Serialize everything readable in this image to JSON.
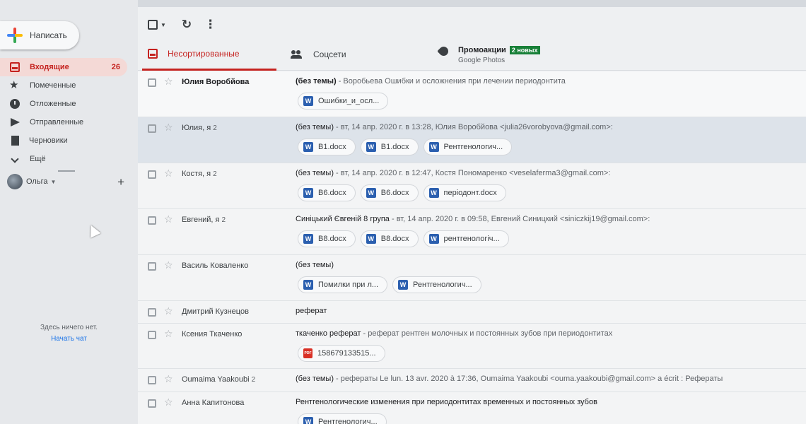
{
  "compose": {
    "label": "Написать"
  },
  "nav": [
    {
      "label": "Входящие",
      "icon": "inbox-icon",
      "count": "26",
      "active": true
    },
    {
      "label": "Помеченные",
      "icon": "star-icon"
    },
    {
      "label": "Отложенные",
      "icon": "clock-icon"
    },
    {
      "label": "Отправленные",
      "icon": "send-icon"
    },
    {
      "label": "Черновики",
      "icon": "draft-icon"
    },
    {
      "label": "Ещё",
      "icon": "chevron-down-icon"
    }
  ],
  "hangouts": {
    "user": "Ольга",
    "empty_text": "Здесь ничего нет.",
    "start_chat": "Начать чат"
  },
  "tabs": {
    "primary": "Несортированные",
    "social": "Соцсети",
    "promo": {
      "label": "Промоакции",
      "badge": "2 новых",
      "sub": "Google Photos"
    }
  },
  "emails": [
    {
      "sender": "Юлия Воробйова",
      "count": "",
      "subject": "(без темы)",
      "snippet": " - Воробьева Ошибки и осложнения при лечении периодонтита",
      "attachments": [
        {
          "type": "word",
          "name": "Ошибки_и_осл..."
        }
      ],
      "unread": true
    },
    {
      "sender": "Юлия, я",
      "count": "2",
      "subject": "(без темы)",
      "snippet": " - вт, 14 апр. 2020 г. в 13:28, Юлия Воробйова <julia26vorobyova@gmail.com>:",
      "attachments": [
        {
          "type": "word",
          "name": "В1.docx"
        },
        {
          "type": "word",
          "name": "В1.docx"
        },
        {
          "type": "word",
          "name": "Рентгенологич..."
        }
      ],
      "selected": true
    },
    {
      "sender": "Костя, я",
      "count": "2",
      "subject": "(без темы)",
      "snippet": " - вт, 14 апр. 2020 г. в 12:47, Костя Пономаренко <veselaferma3@gmail.com>:",
      "attachments": [
        {
          "type": "word",
          "name": "В6.docx"
        },
        {
          "type": "word",
          "name": "В6.docx"
        },
        {
          "type": "word",
          "name": "періодонт.docx"
        }
      ]
    },
    {
      "sender": "Евгений, я",
      "count": "2",
      "subject": "Синіцький Євгеній 8 група",
      "snippet": " - вт, 14 апр. 2020 г. в 09:58, Евгений Синицкий <siniczkij19@gmail.com>:",
      "attachments": [
        {
          "type": "word",
          "name": "В8.docx"
        },
        {
          "type": "word",
          "name": "В8.docx"
        },
        {
          "type": "word",
          "name": "рентгенологіч..."
        }
      ]
    },
    {
      "sender": "Василь Коваленко",
      "count": "",
      "subject": "(без темы)",
      "snippet": "",
      "attachments": [
        {
          "type": "word",
          "name": "Помилки при л..."
        },
        {
          "type": "word",
          "name": "Рентгенологич..."
        }
      ]
    },
    {
      "sender": "Дмитрий Кузнецов",
      "count": "",
      "subject": "реферат",
      "snippet": "",
      "attachments": []
    },
    {
      "sender": "Ксения Ткаченко",
      "count": "",
      "subject": "ткаченко реферат",
      "snippet": " - реферат рентген молочных и постоянных зубов при периодонтитах",
      "attachments": [
        {
          "type": "pdf",
          "name": "158679133515..."
        }
      ]
    },
    {
      "sender": "Oumaima Yaakoubi",
      "count": "2",
      "subject": "(без темы)",
      "snippet": " - рефераты Le lun. 13 avr. 2020 à 17:36, Oumaima Yaakoubi <ouma.yaakoubi@gmail.com> a écrit : Рефераты",
      "attachments": []
    },
    {
      "sender": "Анна Капитонова",
      "count": "",
      "subject": "Рентгенологические изменения при периодонтитах временных и постоянных зубов",
      "snippet": "",
      "attachments": [
        {
          "type": "word",
          "name": "Рентгенологич..."
        }
      ]
    }
  ],
  "icons": {
    "word": "W",
    "pdf": "PDF"
  },
  "colors": {
    "accent": "#c5221f",
    "badge": "#188038",
    "word": "#2b5faf",
    "pdf": "#d93025"
  }
}
